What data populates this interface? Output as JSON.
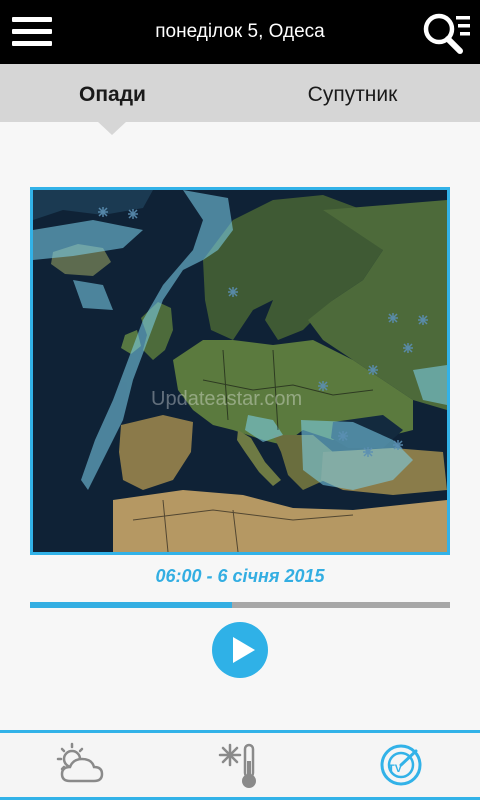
{
  "header": {
    "title": "понеділок 5, Одеса",
    "menu_icon": "hamburger-menu-icon",
    "search_icon": "search-list-icon"
  },
  "tabs": [
    {
      "label": "Опади",
      "selected": true
    },
    {
      "label": "Супутник",
      "selected": false
    }
  ],
  "map": {
    "watermark": "Updateastar.com"
  },
  "timestamp": "06:00 - 6 січня 2015",
  "playback": {
    "progress_percent": 48,
    "play_icon": "play-icon"
  },
  "bottom_nav": [
    {
      "icon": "partly-cloudy-icon",
      "active": false
    },
    {
      "icon": "snowflake-thermometer-icon",
      "active": false
    },
    {
      "icon": "radar-tv-icon",
      "active": true
    }
  ],
  "colors": {
    "accent": "#32b2e8",
    "topbar": "#000000",
    "tabs_bg": "#d6d6d6"
  }
}
